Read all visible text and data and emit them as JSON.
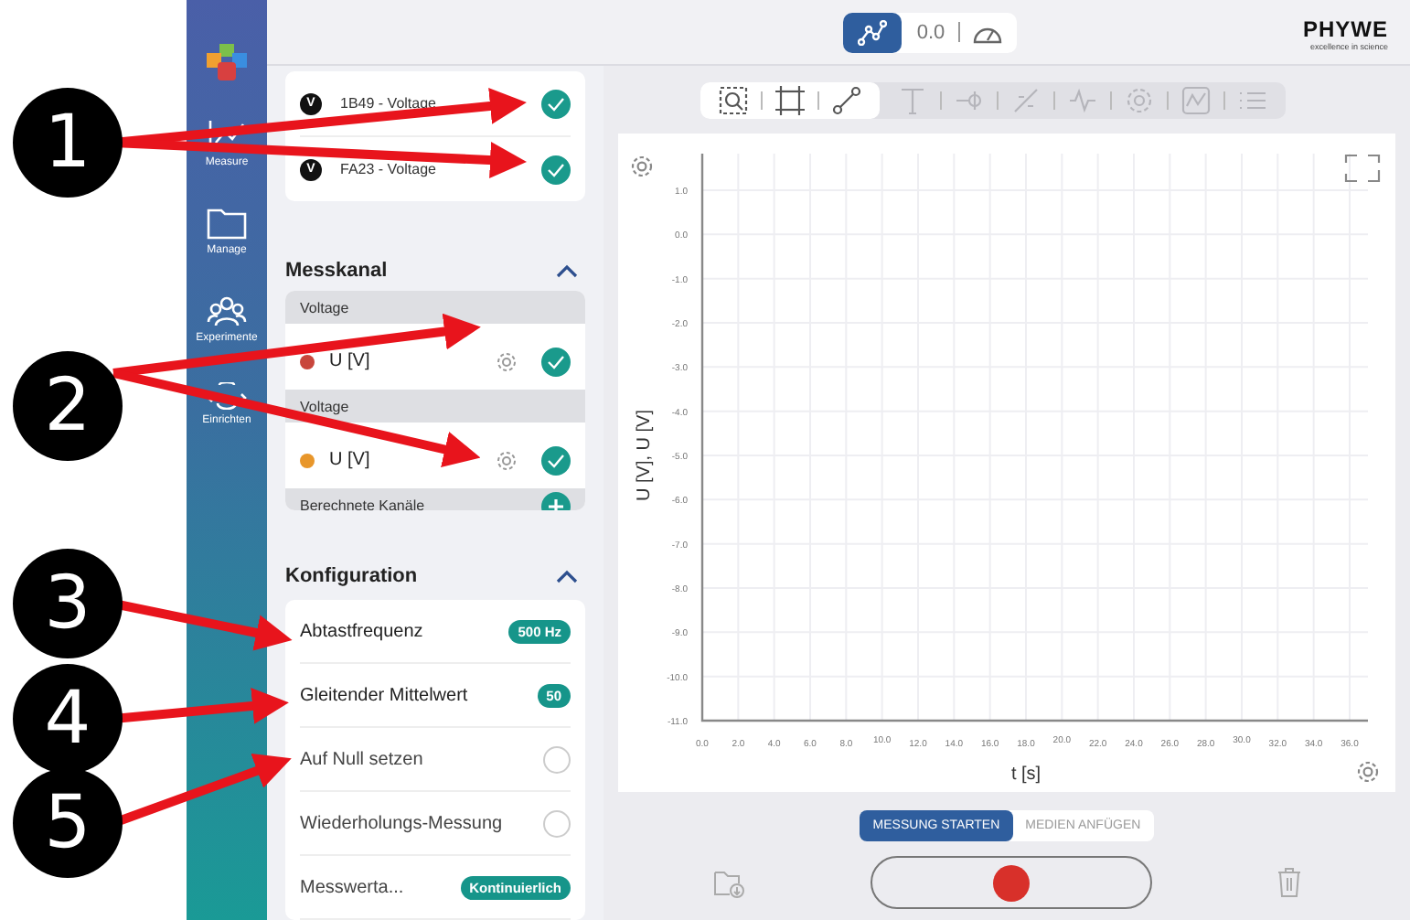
{
  "callouts": [
    {
      "number": "1"
    },
    {
      "number": "2"
    },
    {
      "number": "3"
    },
    {
      "number": "4"
    },
    {
      "number": "5"
    }
  ],
  "nav": {
    "items": [
      {
        "label": "Measure"
      },
      {
        "label": "Manage"
      },
      {
        "label": "Experimente"
      },
      {
        "label": "Einrichten"
      }
    ]
  },
  "topbar": {
    "modes": [
      {
        "kind": "graph",
        "selected": true
      },
      {
        "kind": "reading",
        "text": "0.0",
        "selected": false
      }
    ],
    "logo": "PHYWE",
    "logo_tagline": "excellence in science"
  },
  "sensors": [
    {
      "badge": "V",
      "name": "1B49 - Voltage",
      "checked": true
    },
    {
      "badge": "V",
      "name": "FA23 - Voltage",
      "checked": true
    }
  ],
  "messkanal": {
    "title": "Messkanal",
    "expanded": true,
    "groups": [
      {
        "header": "Voltage",
        "channel": "U [V]",
        "color": "#c8463c",
        "checked": true
      },
      {
        "header": "Voltage",
        "channel": "U [V]",
        "color": "#e8962a",
        "checked": true
      }
    ],
    "computed_label": "Berechnete Kanäle"
  },
  "konfiguration": {
    "title": "Konfiguration",
    "expanded": true,
    "rows": [
      {
        "kind": "badge",
        "label": "Abtastfrequenz",
        "value": "500 Hz"
      },
      {
        "kind": "badge",
        "label": "Gleitender Mittelwert",
        "value": "50"
      },
      {
        "kind": "radio",
        "label": "Auf Null setzen",
        "checked": false
      },
      {
        "kind": "radio",
        "label": "Wiederholungs-Messung",
        "checked": false
      },
      {
        "kind": "badge",
        "label": "Messwerta...",
        "value": "Kontinuierlich"
      }
    ]
  },
  "toolbar": {
    "tools": [
      {
        "enabled": true
      },
      {
        "enabled": true
      },
      {
        "enabled": true
      },
      {
        "enabled": false
      },
      {
        "enabled": false
      },
      {
        "enabled": false
      },
      {
        "enabled": false
      },
      {
        "enabled": false
      },
      {
        "enabled": false
      },
      {
        "enabled": false
      }
    ]
  },
  "chart": {
    "chart_data": {
      "type": "line",
      "xlabel": "t [s]",
      "ylabel": "U [V], U [V]",
      "xlim": [
        0,
        36
      ],
      "ylim": [
        -11,
        1
      ],
      "grid": true,
      "xticks": [
        {
          "value": 0,
          "label": "0.0"
        },
        {
          "value": 2,
          "label": "2.0"
        },
        {
          "value": 4,
          "label": "4.0"
        },
        {
          "value": 6,
          "label": "6.0"
        },
        {
          "value": 8,
          "label": "8.0"
        },
        {
          "value": 10,
          "label": "10.0"
        },
        {
          "value": 12,
          "label": "12.0"
        },
        {
          "value": 14,
          "label": "14.0"
        },
        {
          "value": 16,
          "label": "16.0"
        },
        {
          "value": 18,
          "label": "18.0"
        },
        {
          "value": 20,
          "label": "20.0"
        },
        {
          "value": 22,
          "label": "22.0"
        },
        {
          "value": 24,
          "label": "24.0"
        },
        {
          "value": 26,
          "label": "26.0"
        },
        {
          "value": 28,
          "label": "28.0"
        },
        {
          "value": 30,
          "label": "30.0"
        },
        {
          "value": 32,
          "label": "32.0"
        },
        {
          "value": 34,
          "label": "34.0"
        },
        {
          "value": 36,
          "label": "36.0"
        }
      ],
      "yticks": [
        {
          "value": 1,
          "label": "1.0"
        },
        {
          "value": 0,
          "label": "0.0"
        },
        {
          "value": -1,
          "label": "-1.0"
        },
        {
          "value": -2,
          "label": "-2.0"
        },
        {
          "value": -3,
          "label": "-3.0"
        },
        {
          "value": -4,
          "label": "-4.0"
        },
        {
          "value": -5,
          "label": "-5.0"
        },
        {
          "value": -6,
          "label": "-6.0"
        },
        {
          "value": -7,
          "label": "-7.0"
        },
        {
          "value": -8,
          "label": "-8.0"
        },
        {
          "value": -9,
          "label": "-9.0"
        },
        {
          "value": -10,
          "label": "-10.0"
        },
        {
          "value": -11,
          "label": "-11.0"
        }
      ]
    }
  },
  "actions": [
    {
      "label": "MESSUNG STARTEN",
      "selected": true
    },
    {
      "label": "MEDIEN ANFÜGEN",
      "selected": false
    }
  ],
  "recording": false
}
